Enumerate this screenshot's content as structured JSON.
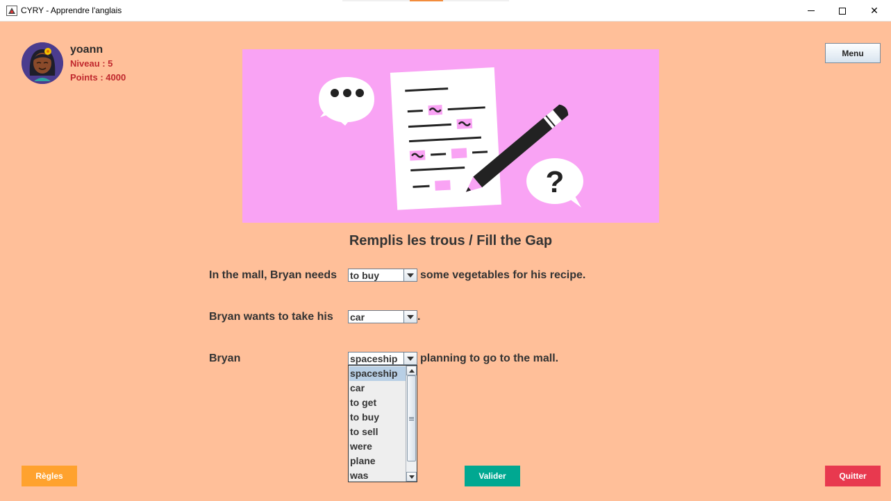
{
  "window": {
    "title": "CYRY - Apprendre l'anglais",
    "minimize_icon": "minimize-icon",
    "maximize_icon": "maximize-icon",
    "close_icon": "close-icon",
    "close_glyph": "✕"
  },
  "user": {
    "name": "yoann",
    "level": "Niveau : 5",
    "points": "Points : 4000",
    "avatar_icon": "avatar-icon"
  },
  "menu_label": "Menu",
  "illustration": {
    "background": "#f9a3f4",
    "icon": "fill-the-gap-illustration"
  },
  "exercise": {
    "title": "Remplis les trous / Fill the Gap",
    "sentences": [
      {
        "before": "In the mall, Bryan needs",
        "selected": "to buy",
        "after": "some vegetables for his recipe."
      },
      {
        "before": "Bryan wants to take his",
        "selected": "car",
        "after": "."
      },
      {
        "before": "Bryan",
        "selected": "spaceship",
        "after": "planning to go to the mall."
      }
    ],
    "dropdown_options": [
      "spaceship",
      "car",
      "to get",
      "to buy",
      "to sell",
      "were",
      "plane",
      "was"
    ],
    "dropdown_highlighted": "spaceship"
  },
  "buttons": {
    "rules": "Règles",
    "validate": "Valider",
    "quit": "Quitter"
  },
  "colors": {
    "background": "#ffbf99",
    "rules": "#ffa22e",
    "validate": "#00a891",
    "quit": "#e8394f",
    "user_stats": "#c0282d"
  }
}
